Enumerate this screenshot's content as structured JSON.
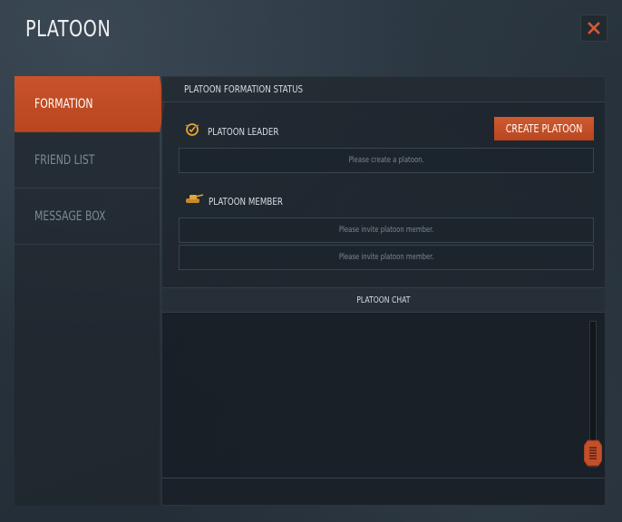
{
  "window": {
    "title": "PLATOON"
  },
  "sidebar": {
    "items": [
      {
        "label": "FORMATION",
        "active": true
      },
      {
        "label": "FRIEND LIST",
        "active": false
      },
      {
        "label": "MESSAGE BOX",
        "active": false
      }
    ]
  },
  "formation": {
    "section_title": "PLATOON FORMATION STATUS",
    "leader_label": "PLATOON LEADER",
    "leader_icon": "leader-badge-icon",
    "create_button_label": "CREATE PLATOON",
    "leader_slot_text": "Please create a platoon.",
    "member_label": "PLATOON MEMBER",
    "member_icon": "tank-icon",
    "member_slots": [
      "Please invite platoon member.",
      "Please invite platoon member."
    ]
  },
  "chat": {
    "title": "PLATOON CHAT",
    "input_value": ""
  },
  "colors": {
    "accent": "#c2502a",
    "background": "#26313b",
    "text": "#d9dde1",
    "muted_text": "#7e8993"
  }
}
